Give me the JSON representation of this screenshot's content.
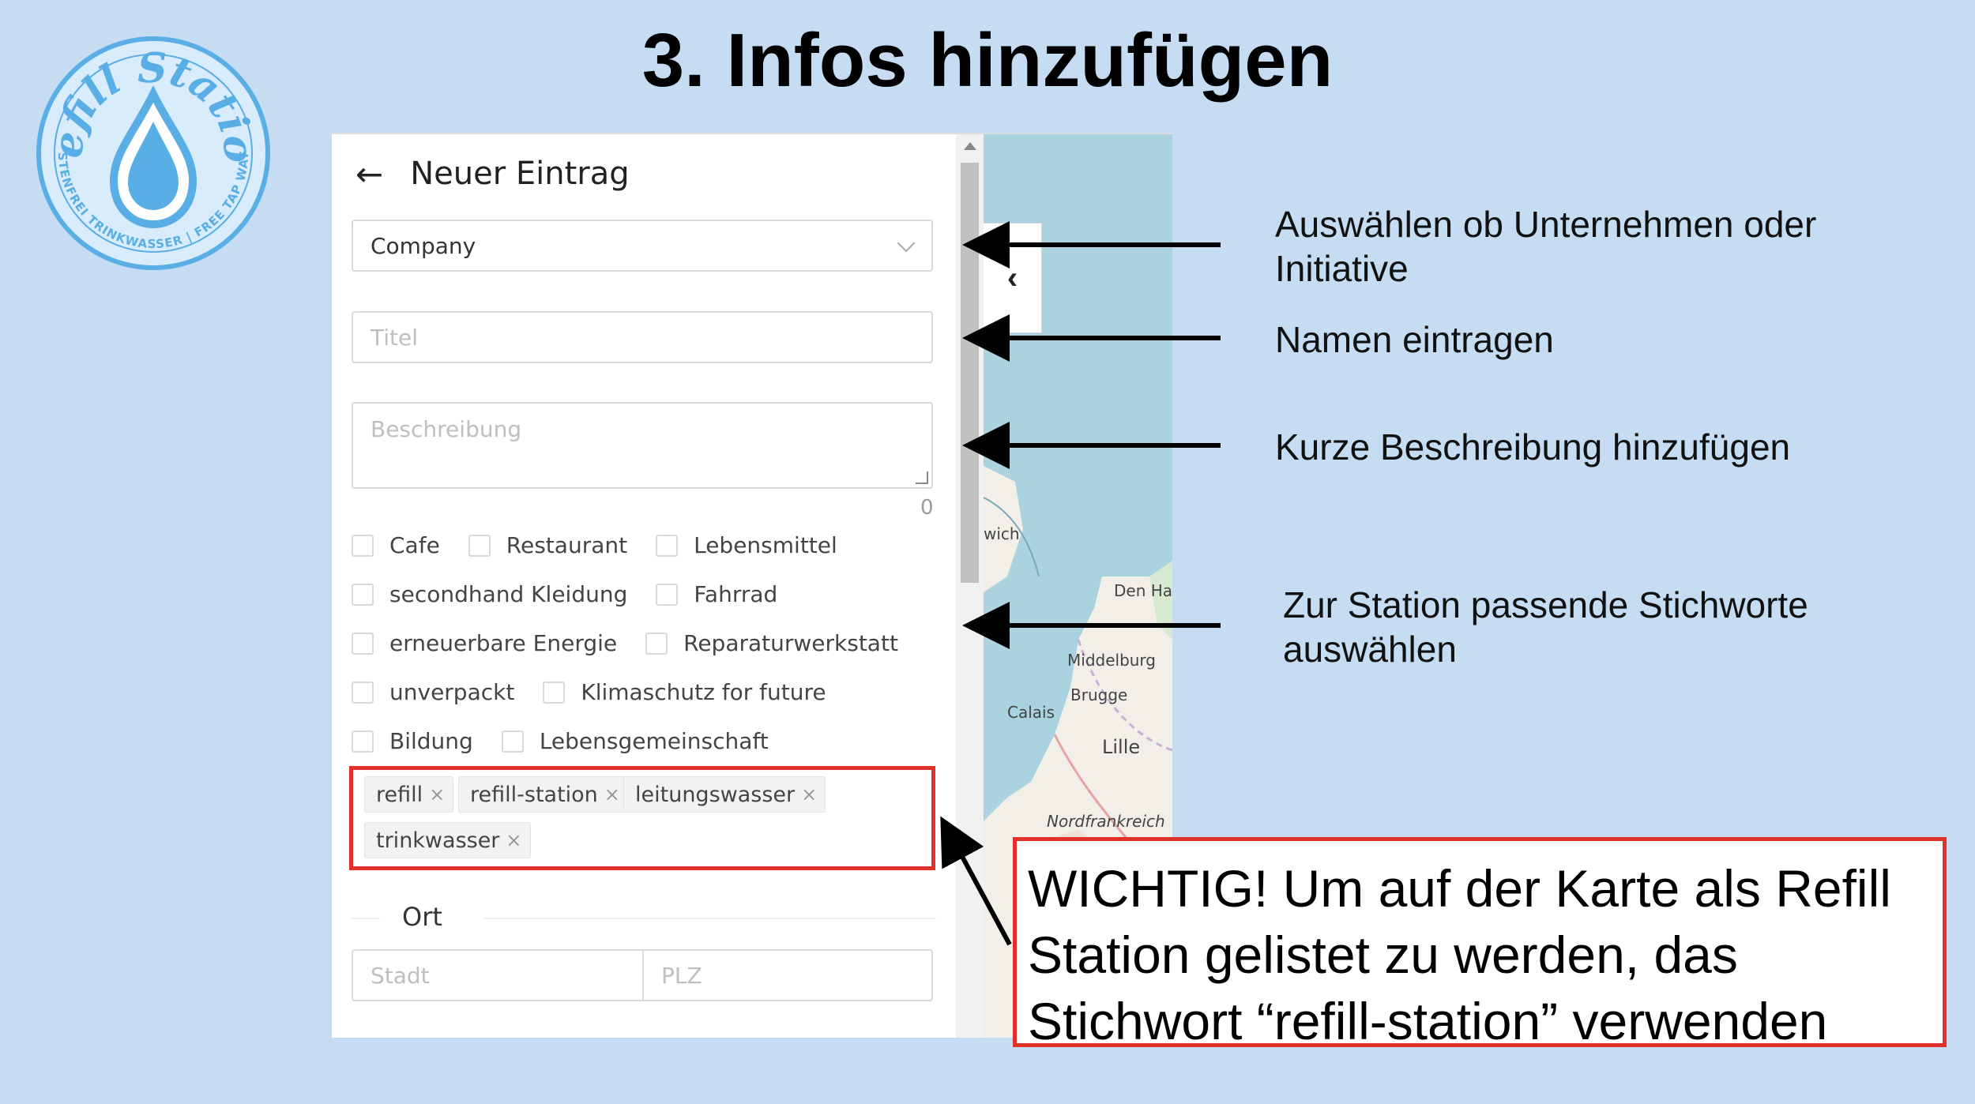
{
  "slide": {
    "title": "3. Infos hinzufügen"
  },
  "logo": {
    "brand_text": "Refill Station",
    "ring_text": "KOSTENFREI TRINKWASSER | FREE TAP WATER",
    "icon": "water-drop-icon",
    "color": "#5aaee6"
  },
  "form": {
    "back_icon": "arrow-left-icon",
    "header_title": "Neuer Eintrag",
    "type_select": {
      "value": "Company"
    },
    "title_input": {
      "placeholder": "Titel"
    },
    "description_input": {
      "placeholder": "Beschreibung",
      "char_count": "0"
    },
    "categories": {
      "cafe": "Cafe",
      "restaurant": "Restaurant",
      "lebensmittel": "Lebensmittel",
      "secondhand": "secondhand Kleidung",
      "fahrrad": "Fahrrad",
      "energie": "erneuerbare Energie",
      "reparatur": "Reparaturwerkstatt",
      "unverpackt": "unverpackt",
      "klimaschutz": "Klimaschutz for future",
      "bildung": "Bildung",
      "lebensgemeinschaft": "Lebensgemeinschaft"
    },
    "tags": {
      "t1": "refill",
      "t2": "refill-station",
      "t3": "leitungswasser",
      "t4": "trinkwasser",
      "remove": "×"
    },
    "location": {
      "section_label": "Ort",
      "city_placeholder": "Stadt",
      "zip_placeholder": "PLZ"
    }
  },
  "map": {
    "toggle_icon": "chevron-left-icon",
    "labels": {
      "ipswich": "wich",
      "den_haag": "Den Ha",
      "middelburg": "Middelburg",
      "brugge": "Brugge",
      "calais": "Calais",
      "lille": "Lille",
      "nordfrankreich": "Nordfrankreich"
    }
  },
  "annotations": {
    "type_note": "Auswählen ob Unternehmen oder Initiative",
    "name_note": "Namen eintragen",
    "desc_note": "Kurze Beschreibung hinzufügen",
    "tags_note": "Zur Station passende Stichworte auswählen",
    "warning": "WICHTIG! Um auf der Karte als Refill Station gelistet zu werden, das Stichwort “refill-station” verwenden",
    "highlight_color": "#e0302a"
  }
}
